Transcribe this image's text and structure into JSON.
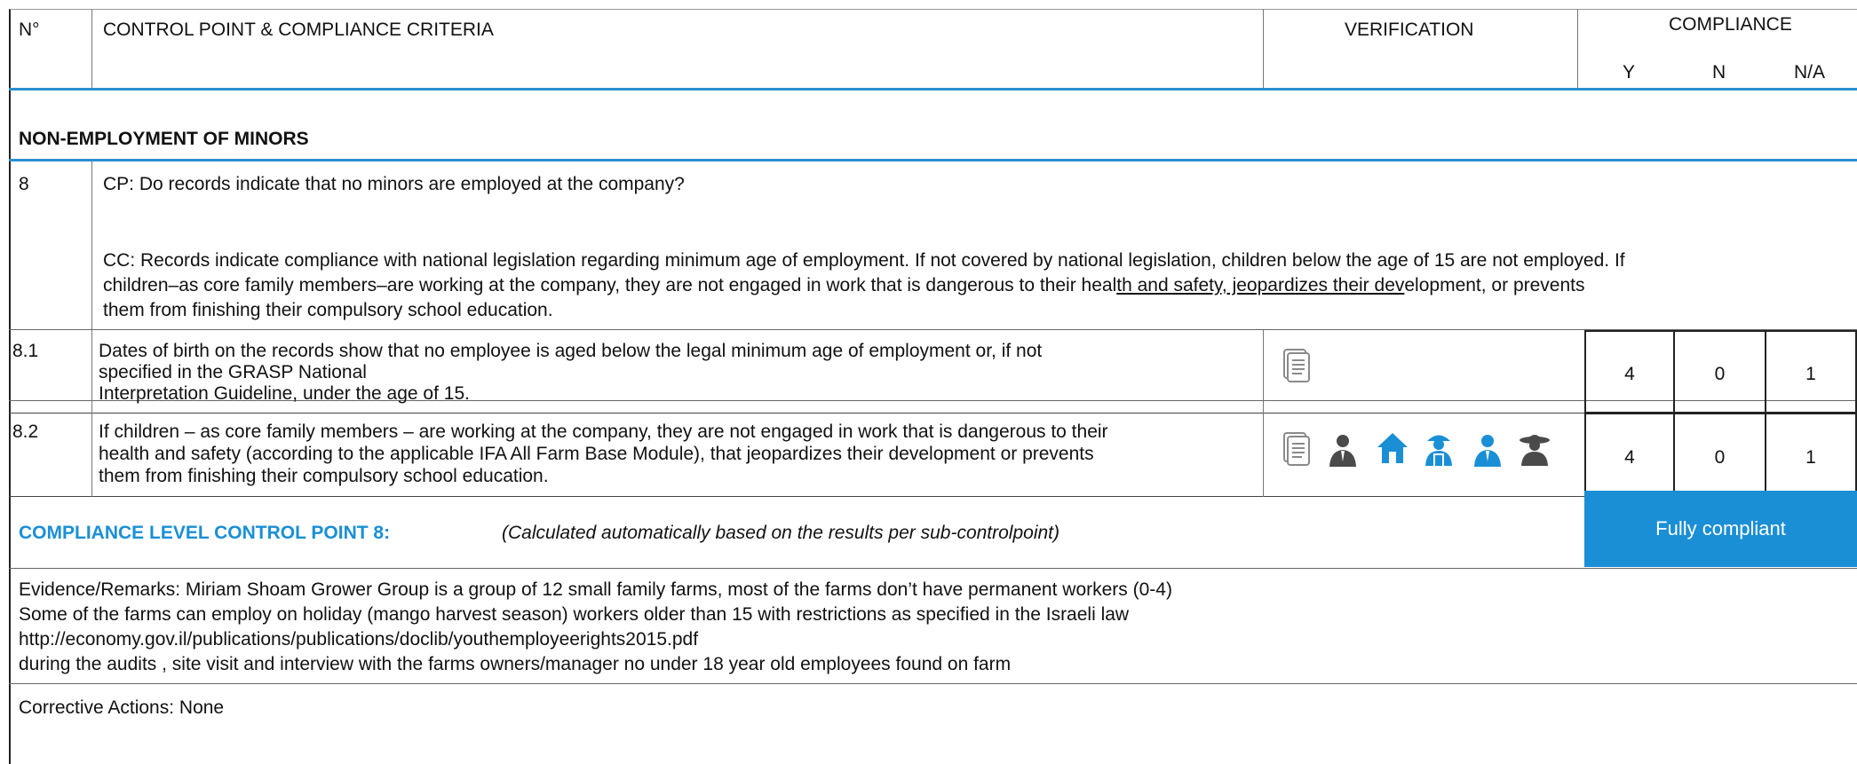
{
  "header": {
    "no": "N°",
    "control_point": "CONTROL POINT & COMPLIANCE CRITERIA",
    "verification": "VERIFICATION",
    "compliance": "COMPLIANCE",
    "y": "Y",
    "n": "N",
    "na": "N/A"
  },
  "section": {
    "title": "NON-EMPLOYMENT OF MINORS"
  },
  "cp8": {
    "number": "8",
    "question": "CP: Do records indicate that no minors are employed at the company?",
    "cc_line1": "CC: Records indicate compliance with national legislation regarding minimum age of employment. If not covered by national legislation, children below the age of 15 are not employed. If",
    "cc_line2_a": "children–as core family members–are working at the company, they are not engaged in work that is dangerous to their heal",
    "cc_line2_b": "th and safety, jeopardizes their dev",
    "cc_line2_c": "elopment, or prevents",
    "cc_line3": "them from finishing their compulsory school education."
  },
  "rows": [
    {
      "number": "8.1",
      "lines": [
        "Dates of birth on the records show that no employee is aged below the legal minimum age of employment or, if not",
        "specified in the GRASP National",
        "Interpretation Guideline, under the age of 15."
      ],
      "y": "4",
      "n": "0",
      "na": "1"
    },
    {
      "number": "8.2",
      "lines": [
        "If children – as core family members – are working at the company, they are not engaged in work that is dangerous to their",
        "health and safety (according to the applicable IFA All Farm Base Module), that jeopardizes their development or prevents",
        "them from finishing their compulsory school education."
      ],
      "y": "4",
      "n": "0",
      "na": "1"
    }
  ],
  "compliance_level": {
    "label": "COMPLIANCE LEVEL CONTROL POINT 8:",
    "note": "(Calculated automatically based on the results per sub-controlpoint)",
    "result": "Fully compliant"
  },
  "evidence": {
    "lines": [
      "Evidence/Remarks: Miriam Shoam Grower Group is a group of 12 small family farms, most of the farms don’t have permanent workers (0-4)",
      "Some of the farms can employ on holiday (mango harvest season) workers older than 15 with restrictions as specified in the Israeli law",
      "http://economy.gov.il/publications/publications/doclib/youthemployeerights2015.pdf",
      "during the audits , site visit and interview with the farms owners/manager no under 18 year old employees found on farm"
    ]
  },
  "corrective": {
    "text": "Corrective Actions: None"
  },
  "icons": {
    "row81": [
      "document-icon"
    ],
    "row82": [
      "document-icon",
      "manager-icon",
      "house-icon",
      "worker-icon",
      "employee-icon",
      "farmer-icon"
    ],
    "colors": {
      "dark": "#4a4a4a",
      "blue": "#1a8fd6",
      "doc": "#8a8a8a"
    }
  }
}
